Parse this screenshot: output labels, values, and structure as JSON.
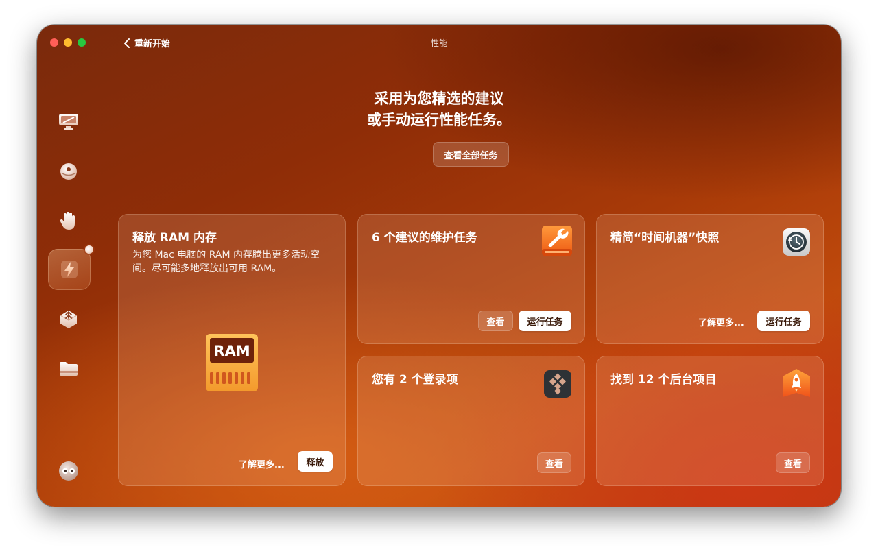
{
  "window": {
    "title": "性能",
    "back_label": "重新开始"
  },
  "headline": {
    "line1": "采用为您精选的建议",
    "line2": "或手动运行性能任务。"
  },
  "view_all_label": "查看全部任务",
  "cards": {
    "ram": {
      "title": "释放 RAM 内存",
      "description": "为您 Mac 电脑的 RAM 内存腾出更多活动空间。尽可能多地释放出可用 RAM。",
      "icon_text": "RAM",
      "learn_more": "了解更多...",
      "action": "释放"
    },
    "maintenance": {
      "title": "6 个建议的维护任务",
      "view": "查看",
      "action": "运行任务"
    },
    "timemachine": {
      "title": "精简“时间机器”快照",
      "learn_more": "了解更多...",
      "action": "运行任务"
    },
    "login": {
      "title": "您有 2 个登录项",
      "view": "查看"
    },
    "background": {
      "title": "找到 12 个后台项目",
      "view": "查看"
    }
  },
  "sidebar": {
    "items": [
      {
        "name": "cleanup",
        "icon": "monitor-icon"
      },
      {
        "name": "protection",
        "icon": "shield-ball-icon"
      },
      {
        "name": "privacy",
        "icon": "hand-icon"
      },
      {
        "name": "performance",
        "icon": "lightning-icon",
        "active": true
      },
      {
        "name": "applications",
        "icon": "apps-icon"
      },
      {
        "name": "clutter",
        "icon": "folder-icon"
      }
    ],
    "assistant_icon": "assistant-icon"
  },
  "colors": {
    "accent": "#c04a0c",
    "close": "#ff5f57",
    "minimize": "#febc2e",
    "zoom": "#28c840"
  }
}
